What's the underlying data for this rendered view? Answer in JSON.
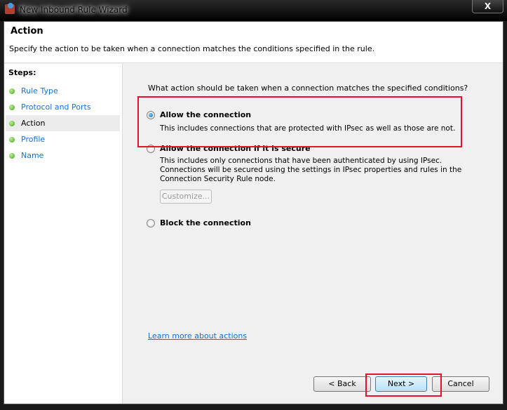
{
  "window": {
    "title": "New Inbound Rule Wizard",
    "close_label": "X"
  },
  "header": {
    "title": "Action",
    "description": "Specify the action to be taken when a connection matches the conditions specified in the rule."
  },
  "steps": {
    "heading": "Steps:",
    "items": [
      {
        "label": "Rule Type"
      },
      {
        "label": "Protocol and Ports"
      },
      {
        "label": "Action",
        "current": true
      },
      {
        "label": "Profile"
      },
      {
        "label": "Name"
      }
    ]
  },
  "main": {
    "question": "What action should be taken when a connection matches the specified conditions?",
    "options": [
      {
        "label": "Allow the connection",
        "description": "This includes connections that are protected with IPsec as well as those are not.",
        "selected": true
      },
      {
        "label": "Allow the connection if it is secure",
        "description": "This includes only connections that have been authenticated by using IPsec.  Connections will be secured using the settings in IPsec properties and rules in the Connection Security Rule node.",
        "selected": false
      },
      {
        "label": "Block the connection",
        "selected": false
      }
    ],
    "customize_label": "Customize...",
    "learn_more": "Learn more about actions"
  },
  "buttons": {
    "back": "< Back",
    "next": "Next >",
    "cancel": "Cancel"
  },
  "colors": {
    "highlight": "#e8102a",
    "link": "#1a6fd0"
  }
}
